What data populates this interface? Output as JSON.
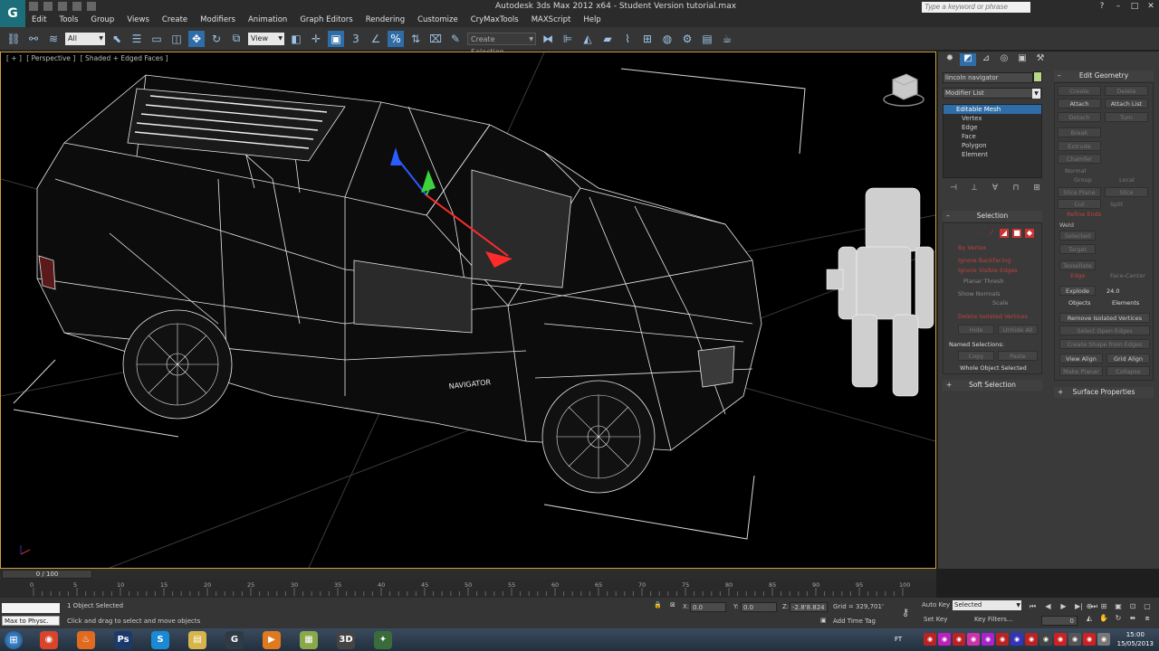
{
  "window": {
    "title": "Autodesk 3ds Max  2012 x64    -  Student Version    tutorial.max",
    "search_placeholder": "Type a keyword or phrase",
    "logo_letter": "G"
  },
  "menu": [
    "Edit",
    "Tools",
    "Group",
    "Views",
    "Create",
    "Modifiers",
    "Animation",
    "Graph Editors",
    "Rendering",
    "Customize",
    "CryMaxTools",
    "MAXScript",
    "Help"
  ],
  "toolbar": {
    "filter_value": "All",
    "coord_system": "View",
    "selection_set_placeholder": "Create Selection"
  },
  "viewport": {
    "label_parts": [
      "[ + ]",
      "[ Perspective ]",
      "[ Shaded + Edged Faces ]"
    ],
    "car_badge": "NAVIGATOR"
  },
  "command_panel": {
    "object_name": "lincoln navigator",
    "object_color": "#b8d884",
    "modifier_list": "Modifier List",
    "stack": [
      "Editable Mesh",
      "Vertex",
      "Edge",
      "Face",
      "Polygon",
      "Element"
    ],
    "selection_title": "Selection",
    "selection_options": [
      "By Vertex",
      "Ignore Backfacing",
      "Ignore Visible Edges",
      "Planar Thresh",
      "Show Normals",
      "Scale",
      "Delete Isolated Vertices",
      "Hide",
      "Unhide All"
    ],
    "named_selections": "Named Selections:",
    "copy_label": "Copy",
    "paste_label": "Paste",
    "whole_object": "Whole Object Selected",
    "soft_selection": "Soft Selection",
    "edit_geometry_title": "Edit Geometry",
    "edit_geometry_buttons": [
      "Create",
      "Delete",
      "Attach",
      "Attach List",
      "Detach",
      "Break",
      "Turn",
      "Extrude",
      "Chamfer",
      "Normal",
      "Group",
      "Local",
      "Slice Plane",
      "Slice",
      "Cut",
      "Split",
      "Refine Ends",
      "Weld",
      "Selected",
      "Target",
      "Tessellate",
      "Edge",
      "Face-Center",
      "Explode",
      "Objects",
      "Elements",
      "Remove Isolated Vertices",
      "Select Open Edges",
      "Create Shape from Edges",
      "View Align",
      "Grid Align",
      "Make Planar",
      "Collapse"
    ],
    "explode_value": "24.0",
    "surface_properties": "Surface Properties"
  },
  "timeline": {
    "frame_display": "0 / 100",
    "ticks": [
      "0",
      "5",
      "10",
      "15",
      "20",
      "25",
      "30",
      "35",
      "40",
      "45",
      "50",
      "55",
      "60",
      "65",
      "70",
      "75",
      "80",
      "85",
      "90",
      "95",
      "100"
    ]
  },
  "status": {
    "maxscript_line": "",
    "script_button": "Max to Physc.",
    "objects_selected": "1 Object Selected",
    "prompt": "Click and drag to select and move objects",
    "x_label": "X:",
    "x_value": "0.0",
    "y_label": "Y:",
    "y_value": "0.0",
    "z_label": "Z:",
    "z_value": "-2.8'8.824",
    "grid": "Grid = 329,701'",
    "add_time_tag": "Add Time Tag",
    "auto_key": "Auto Key",
    "set_key": "Set Key",
    "key_mode": "Selected",
    "key_filters": "Key Filters...",
    "frame_value": "0"
  },
  "taskbar": {
    "apps": [
      {
        "name": "chrome",
        "glyph": "◉",
        "color": "#d9442b"
      },
      {
        "name": "java",
        "glyph": "♨",
        "color": "#e06b1f"
      },
      {
        "name": "photoshop",
        "glyph": "Ps",
        "color": "#1b3a6b"
      },
      {
        "name": "skype",
        "glyph": "S",
        "color": "#1a8ad4"
      },
      {
        "name": "explorer",
        "glyph": "▤",
        "color": "#d7b54a"
      },
      {
        "name": "3dsmax",
        "glyph": "G",
        "color": "#2f3a44"
      },
      {
        "name": "media-player",
        "glyph": "▶",
        "color": "#e07a1f"
      },
      {
        "name": "folder",
        "glyph": "▦",
        "color": "#8aa84a"
      },
      {
        "name": "app-3d",
        "glyph": "3D",
        "color": "#444"
      },
      {
        "name": "green-app",
        "glyph": "✦",
        "color": "#3a6b3a"
      }
    ],
    "language": "FT",
    "time": "15:00",
    "date": "15/05/2013"
  }
}
